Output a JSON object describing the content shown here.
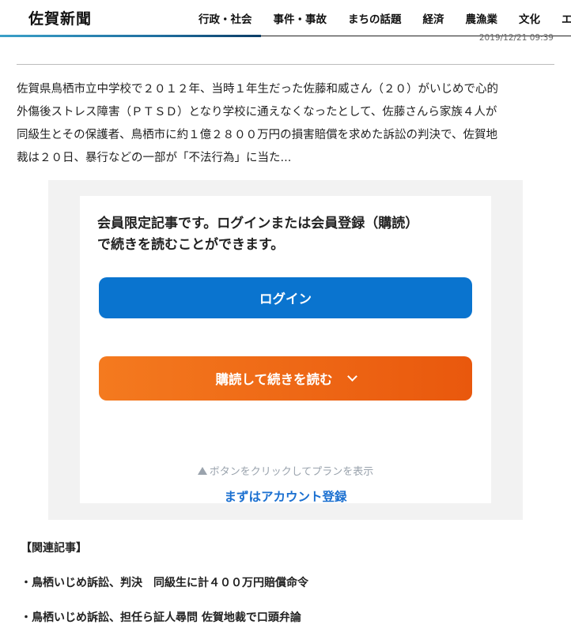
{
  "header": {
    "logo": "佐賀新聞",
    "nav": [
      "行政・社会",
      "事件・事故",
      "まちの話題",
      "経済",
      "農漁業",
      "文化",
      "エ"
    ]
  },
  "article": {
    "timestamp": "2019/12/21 09:39",
    "lead_lines": [
      "佐賀県鳥栖市立中学校で２０１２年、当時１年生だった佐藤和威さん（２０）がいじめで心的",
      "外傷後ストレス障害（ＰＴＳＤ）となり学校に通えなくなったとして、佐藤さんら家族４人が",
      "同級生とその保護者、鳥栖市に約１億２８００万円の損害賠償を求めた訴訟の判決で、佐賀地",
      "裁は２０日、暴行などの一部が「不法行為」に当た..."
    ]
  },
  "paywall": {
    "message_line1": "会員限定記事です。ログインまたは会員登録（購読）",
    "message_line2": "で続きを読むことができます。",
    "login_label": "ログイン",
    "subscribe_label": "購読して続きを読む",
    "plan_hint": "ボタンをクリックしてプランを表示",
    "account_link": "まずはアカウント登録"
  },
  "related": {
    "heading": "【関連記事】",
    "items": [
      "・鳥栖いじめ訴訟、判決　同級生に計４００万円賠償命令",
      "・鳥栖いじめ訴訟、担任ら証人尋問 佐賀地裁で口頭弁論"
    ]
  },
  "colors": {
    "login_button": "#0a74cf",
    "subscribe_button": "#f47a1f",
    "account_link": "#1a6fd0"
  }
}
